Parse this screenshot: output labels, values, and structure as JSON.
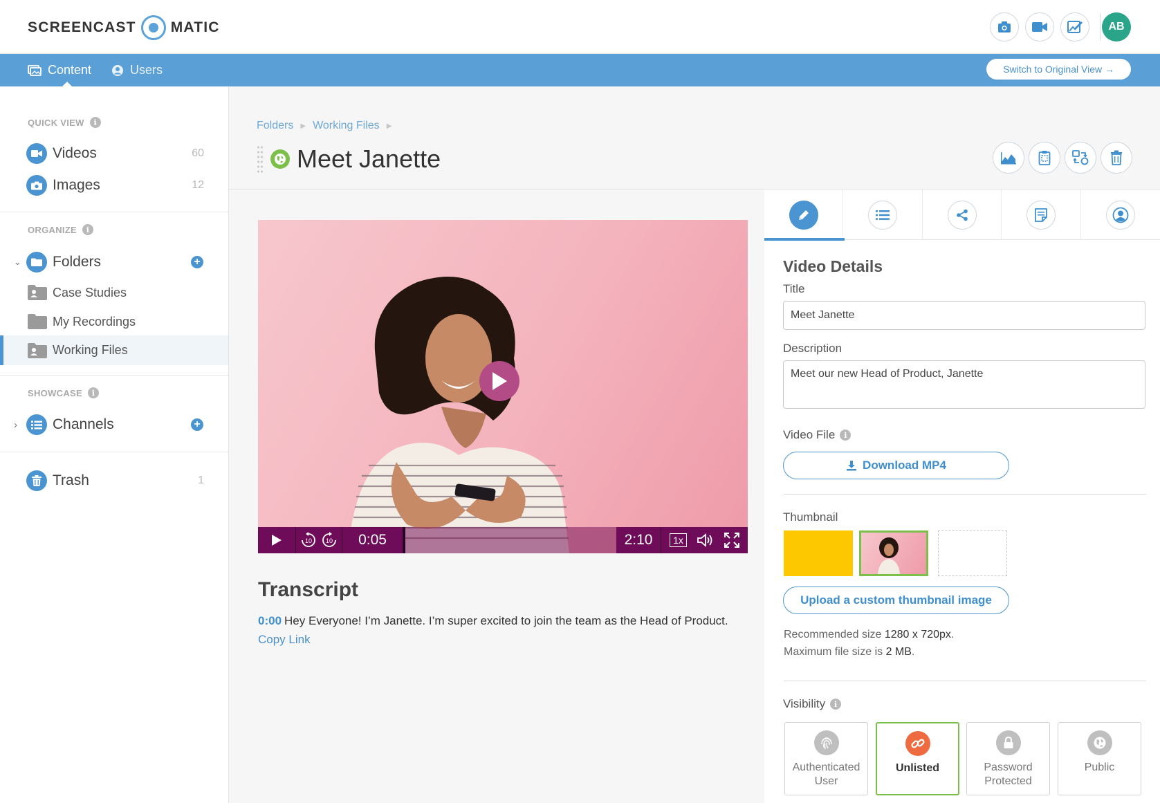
{
  "brand": {
    "left": "SCREENCAST",
    "right": "MATIC"
  },
  "user": {
    "initials": "AB"
  },
  "nav": {
    "content_label": "Content",
    "users_label": "Users",
    "switch_label": "Switch to Original View →"
  },
  "sidebar": {
    "quick_view": {
      "heading": "QUICK VIEW",
      "items": [
        {
          "label": "Videos",
          "count": "60"
        },
        {
          "label": "Images",
          "count": "12"
        }
      ]
    },
    "organize": {
      "heading": "ORGANIZE",
      "folders_label": "Folders",
      "folders": [
        {
          "label": "Case Studies"
        },
        {
          "label": "My Recordings"
        },
        {
          "label": "Working Files"
        }
      ]
    },
    "showcase": {
      "heading": "SHOWCASE",
      "channels_label": "Channels"
    },
    "trash": {
      "label": "Trash",
      "count": "1"
    }
  },
  "breadcrumb": [
    "Folders",
    "Working Files"
  ],
  "page": {
    "title": "Meet Janette"
  },
  "player": {
    "current_time": "0:05",
    "duration": "2:10",
    "speed": "1x",
    "progress": 0.04
  },
  "transcript": {
    "title": "Transcript",
    "timestamp": "0:00",
    "text": "Hey Everyone! I’m Janette. I’m super excited to join the team as the Head of Product.",
    "copy_link": "Copy Link"
  },
  "details": {
    "heading": "Video Details",
    "title_label": "Title",
    "title_value": "Meet Janette",
    "description_label": "Description",
    "description_value": "Meet our new Head of Product, Janette",
    "video_file_label": "Video File",
    "download_label": "Download MP4",
    "thumbnail_label": "Thumbnail",
    "upload_label": "Upload a custom thumbnail image",
    "recommended_prefix": "Recommended size ",
    "recommended_value": "1280 x 720px",
    "max_prefix": "Maximum file size is ",
    "max_value": "2 MB",
    "visibility_label": "Visibility",
    "visibility_options": [
      {
        "line1": "Authenticated",
        "line2": "User"
      },
      {
        "line1": "Unlisted",
        "line2": ""
      },
      {
        "line1": "Password",
        "line2": "Protected"
      },
      {
        "line1": "Public",
        "line2": ""
      }
    ],
    "visibility_selected": "Unlisted"
  },
  "colors": {
    "accent": "#4a95d1",
    "nav_bar": "#5a9fd6",
    "selected_border": "#7cc04b",
    "unlisted_icon": "#ee6b42",
    "thumb_yellow": "#fdc800",
    "player_controls": "#6f0c5a"
  },
  "icons": {
    "top_actions": [
      "camera-icon",
      "video-camera-icon",
      "edit-image-icon"
    ],
    "head_actions": [
      "analytics-icon",
      "clipboard-icon",
      "replace-icon",
      "trash-icon"
    ],
    "tabs": [
      "pencil-icon",
      "list-icon",
      "share-icon",
      "notes-icon",
      "person-icon"
    ]
  }
}
